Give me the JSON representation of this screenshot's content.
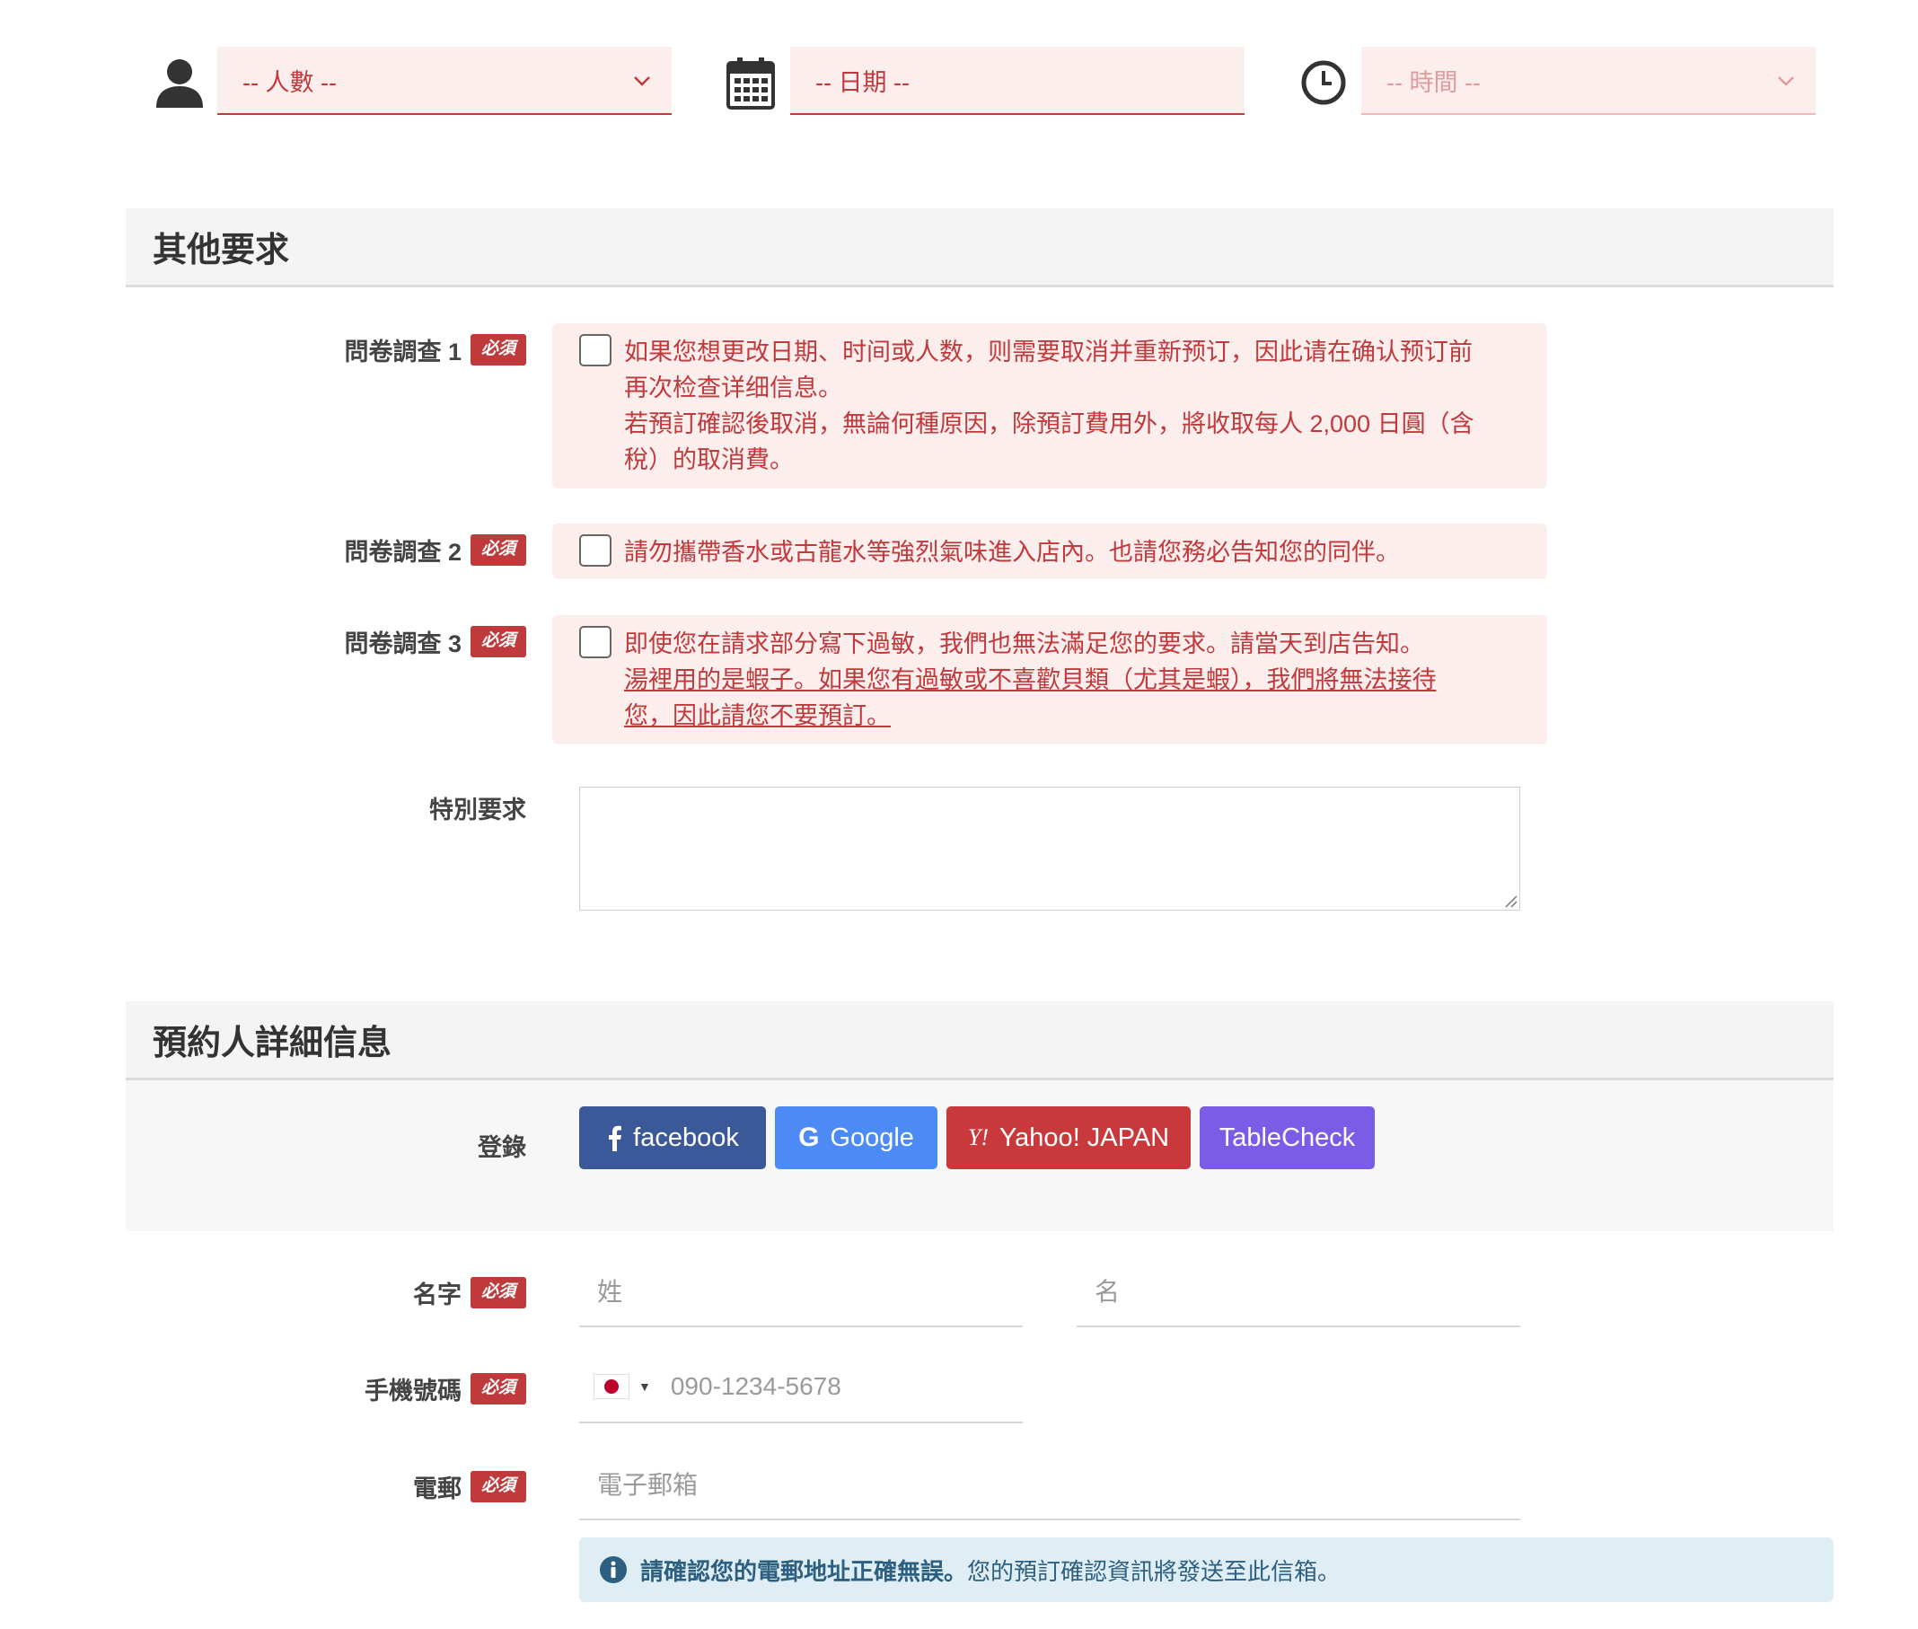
{
  "selectors": {
    "people_placeholder": "-- 人數 --",
    "date_placeholder": "-- 日期 --",
    "time_placeholder": "-- 時間 --"
  },
  "other_requests": {
    "title": "其他要求",
    "required_badge": "必須",
    "questions": [
      {
        "label": "問卷調查 1",
        "lines": [
          "如果您想更改日期、时间或人数，则需要取消并重新预订，因此请在确认预订前",
          "再次检查详细信息。",
          "若預訂確認後取消，無論何種原因，除預訂費用外，將收取每人 2,000 日圓（含",
          "稅）的取消費。"
        ]
      },
      {
        "label": "問卷調查 2",
        "lines": [
          "請勿攜帶香水或古龍水等強烈氣味進入店內。也請您務必告知您的同伴。"
        ]
      },
      {
        "label": "問卷調查 3",
        "lines": [
          "即使您在請求部分寫下過敏，我們也無法滿足您的要求。請當天到店告知。"
        ],
        "underlined_lines": [
          "湯裡用的是蝦子。如果您有過敏或不喜歡貝類（尤其是蝦），我們將無法接待",
          "您，因此請您不要預訂。"
        ]
      }
    ],
    "special_request_label": "特別要求"
  },
  "booker": {
    "title": "預約人詳細信息",
    "login_label": "登錄",
    "login_buttons": [
      {
        "label": "facebook",
        "color": "#3b5998"
      },
      {
        "label": "Google",
        "color": "#4c8bf5"
      },
      {
        "label": "Yahoo! JAPAN",
        "color": "#c9393b"
      },
      {
        "label": "TableCheck",
        "color": "#7b5ce6"
      }
    ],
    "name_label": "名字",
    "last_name_placeholder": "姓",
    "first_name_placeholder": "名",
    "phone_label": "手機號碼",
    "phone_placeholder": "090-1234-5678",
    "email_label": "電郵",
    "email_placeholder": "電子郵箱",
    "info_bold": "請確認您的電郵地址正確無誤。",
    "info_text": "您的預訂確認資訊將發送至此信箱。"
  },
  "colors": {
    "accent": "#c0393b",
    "field_bg": "#fdeeee",
    "info_bg": "#dfeef5"
  }
}
